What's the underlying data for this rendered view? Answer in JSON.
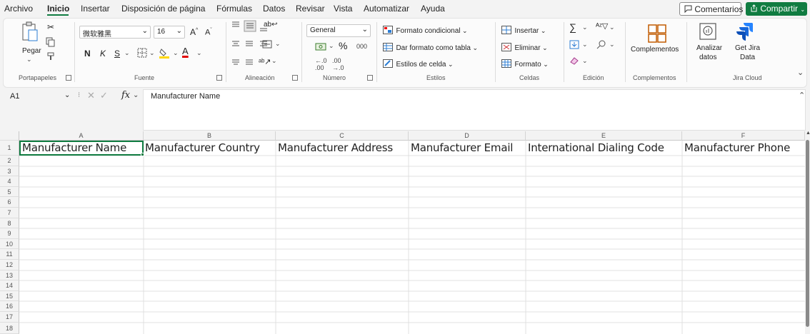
{
  "menu": {
    "items": [
      "Archivo",
      "Inicio",
      "Insertar",
      "Disposición de página",
      "Fórmulas",
      "Datos",
      "Revisar",
      "Vista",
      "Automatizar",
      "Ayuda"
    ],
    "active": "Inicio",
    "comments_label": "Comentarios",
    "share_label": "Compartir"
  },
  "ribbon": {
    "clipboard": {
      "paste_label": "Pegar",
      "group_label": "Portapapeles"
    },
    "font": {
      "font_name": "微软雅黑",
      "font_size": "16",
      "bold": "N",
      "italic": "K",
      "underline": "S",
      "font_color_letter": "A",
      "grow_label": "A",
      "shrink_label": "A",
      "group_label": "Fuente"
    },
    "alignment": {
      "group_label": "Alineación"
    },
    "number": {
      "format": "General",
      "percent": "%",
      "thousands": "000",
      "group_label": "Número"
    },
    "styles": {
      "conditional_format": "Formato condicional",
      "format_as_table": "Dar formato como tabla",
      "cell_styles": "Estilos de celda",
      "group_label": "Estilos"
    },
    "cells": {
      "insert": "Insertar",
      "delete": "Eliminar",
      "format": "Formato",
      "group_label": "Celdas"
    },
    "editing": {
      "group_label": "Edición"
    },
    "addins": {
      "label": "Complementos",
      "group_label": "Complementos"
    },
    "analyze": {
      "label_line1": "Analizar",
      "label_line2": "datos"
    },
    "jira": {
      "label_line1": "Get Jira",
      "label_line2": "Data",
      "group_label": "Jira Cloud"
    }
  },
  "formula_bar": {
    "cell_ref": "A1",
    "fx": "fx",
    "content": "Manufacturer Name"
  },
  "sheet": {
    "columns": [
      "A",
      "B",
      "C",
      "D",
      "E",
      "F"
    ],
    "rows": [
      "1",
      "2",
      "3",
      "4",
      "5",
      "6",
      "7",
      "8",
      "9",
      "10",
      "11",
      "12",
      "13",
      "14",
      "15",
      "16",
      "17",
      "18"
    ],
    "headers": [
      "Manufacturer Name",
      "Manufacturer Country",
      "Manufacturer Address",
      "Manufacturer Email",
      "International Dialing Code",
      "Manufacturer Phone"
    ],
    "selected_cell": "A1"
  },
  "colors": {
    "accent": "#107c41",
    "background": "#f3f3f3"
  }
}
